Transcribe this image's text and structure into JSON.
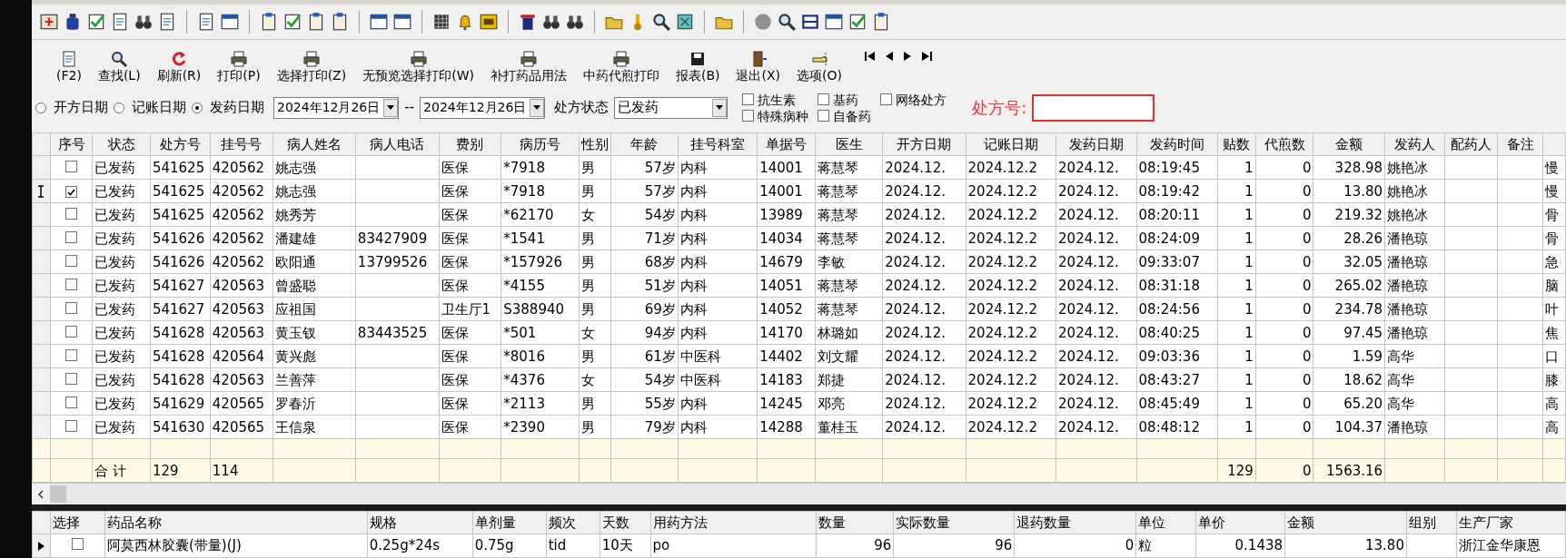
{
  "toolbar": {
    "buttons": [
      {
        "label": "(F2)"
      },
      {
        "label": "查找(L)"
      },
      {
        "label": "刷新(R)"
      },
      {
        "label": "打印(P)"
      },
      {
        "label": "选择打印(Z)"
      },
      {
        "label": "无预览选择打印(W)"
      },
      {
        "label": "补打药品用法"
      },
      {
        "label": "中药代煎打印"
      },
      {
        "label": "报表(B)"
      },
      {
        "label": "退出(X)"
      },
      {
        "label": "选项(O)"
      }
    ]
  },
  "filters": {
    "date_modes": [
      {
        "label": "开方日期",
        "selected": false
      },
      {
        "label": "记账日期",
        "selected": false
      },
      {
        "label": "发药日期",
        "selected": true
      }
    ],
    "date_from": "2024年12月26日",
    "separator": "--",
    "date_to": "2024年12月26日",
    "status_label": "处方状态",
    "status_value": "已发药",
    "options": [
      {
        "label": "抗生素",
        "checked": false
      },
      {
        "label": "特殊病种",
        "checked": false
      },
      {
        "label": "基药",
        "checked": false
      },
      {
        "label": "自备药",
        "checked": false
      },
      {
        "label": "网络处方",
        "checked": false
      }
    ],
    "rx_label": "处方号:"
  },
  "grid": {
    "columns": [
      "序号",
      "状态",
      "处方号",
      "挂号号",
      "病人姓名",
      "病人电话",
      "费别",
      "病历号",
      "性别",
      "年龄",
      "挂号科室",
      "单据号",
      "医生",
      "开方日期",
      "记账日期",
      "发药日期",
      "发药时间",
      "贴数",
      "代煎数",
      "金额",
      "发药人",
      "配药人",
      "备注"
    ],
    "rows": [
      {
        "current": false,
        "checked": false,
        "status": "已发药",
        "rx_no": "541625",
        "reg_no": "420562",
        "patient": "姚志强",
        "fee_type": "医保",
        "record_no": "*7918",
        "sex": "男",
        "age": "57岁",
        "dept": "内科",
        "bill_no": "14001",
        "doctor": "蒋慧琴",
        "rx_date": "2024.12.",
        "acct_date": "2024.12.2",
        "disp_date": "2024.12.",
        "disp_time": "08:19:45",
        "doses": "1",
        "decoct": "0",
        "amount": "328.98",
        "dispenser": "姚艳冰",
        "column_25": "慢"
      },
      {
        "current": true,
        "checked": true,
        "status": "已发药",
        "rx_no": "541625",
        "reg_no": "420562",
        "patient": "姚志强",
        "fee_type": "医保",
        "record_no": "*7918",
        "sex": "男",
        "age": "57岁",
        "dept": "内科",
        "bill_no": "14001",
        "doctor": "蒋慧琴",
        "rx_date": "2024.12.",
        "acct_date": "2024.12.2",
        "disp_date": "2024.12.",
        "disp_time": "08:19:42",
        "doses": "1",
        "decoct": "0",
        "amount": "13.80",
        "dispenser": "姚艳冰",
        "column_25": "慢"
      },
      {
        "current": false,
        "checked": false,
        "status": "已发药",
        "rx_no": "541625",
        "reg_no": "420562",
        "patient": "姚秀芳",
        "fee_type": "医保",
        "record_no": "*62170",
        "sex": "女",
        "age": "54岁",
        "dept": "内科",
        "bill_no": "13989",
        "doctor": "蒋慧琴",
        "rx_date": "2024.12.",
        "acct_date": "2024.12.2",
        "disp_date": "2024.12.",
        "disp_time": "08:20:11",
        "doses": "1",
        "decoct": "0",
        "amount": "219.32",
        "dispenser": "姚艳冰",
        "column_25": "骨"
      },
      {
        "current": false,
        "checked": false,
        "status": "已发药",
        "rx_no": "541626",
        "reg_no": "420562",
        "patient": "潘建雄",
        "phone": "83427909",
        "fee_type": "医保",
        "record_no": "*1541",
        "sex": "男",
        "age": "71岁",
        "dept": "内科",
        "bill_no": "14034",
        "doctor": "蒋慧琴",
        "rx_date": "2024.12.",
        "acct_date": "2024.12.2",
        "disp_date": "2024.12.",
        "disp_time": "08:24:09",
        "doses": "1",
        "decoct": "0",
        "amount": "28.26",
        "dispenser": "潘艳琼",
        "column_25": "骨"
      },
      {
        "current": false,
        "checked": false,
        "status": "已发药",
        "rx_no": "541626",
        "reg_no": "420562",
        "patient": "欧阳通",
        "phone": "13799526",
        "fee_type": "医保",
        "record_no": "*157926",
        "sex": "男",
        "age": "68岁",
        "dept": "内科",
        "bill_no": "14679",
        "doctor": "李敏",
        "rx_date": "2024.12.",
        "acct_date": "2024.12.2",
        "disp_date": "2024.12.",
        "disp_time": "09:33:07",
        "doses": "1",
        "decoct": "0",
        "amount": "32.05",
        "dispenser": "潘艳琼",
        "column_25": "急"
      },
      {
        "current": false,
        "checked": false,
        "status": "已发药",
        "rx_no": "541627",
        "reg_no": "420563",
        "patient": "曾盛聪",
        "fee_type": "医保",
        "record_no": "*4155",
        "sex": "男",
        "age": "51岁",
        "dept": "内科",
        "bill_no": "14051",
        "doctor": "蒋慧琴",
        "rx_date": "2024.12.",
        "acct_date": "2024.12.2",
        "disp_date": "2024.12.",
        "disp_time": "08:31:18",
        "doses": "1",
        "decoct": "0",
        "amount": "265.02",
        "dispenser": "潘艳琼",
        "column_25": "脑"
      },
      {
        "current": false,
        "checked": false,
        "status": "已发药",
        "rx_no": "541627",
        "reg_no": "420563",
        "patient": "应祖国",
        "fee_type": "卫生厅1",
        "record_no": "S388940",
        "sex": "男",
        "age": "69岁",
        "dept": "内科",
        "bill_no": "14052",
        "doctor": "蒋慧琴",
        "rx_date": "2024.12.",
        "acct_date": "2024.12.2",
        "disp_date": "2024.12.",
        "disp_time": "08:24:56",
        "doses": "1",
        "decoct": "0",
        "amount": "234.78",
        "dispenser": "潘艳琼",
        "column_25": "叶"
      },
      {
        "current": false,
        "checked": false,
        "status": "已发药",
        "rx_no": "541628",
        "reg_no": "420563",
        "patient": "黄玉钗",
        "phone": "83443525",
        "fee_type": "医保",
        "record_no": "*501",
        "sex": "女",
        "age": "94岁",
        "dept": "内科",
        "bill_no": "14170",
        "doctor": "林璐如",
        "rx_date": "2024.12.",
        "acct_date": "2024.12.2",
        "disp_date": "2024.12.",
        "disp_time": "08:40:25",
        "doses": "1",
        "decoct": "0",
        "amount": "97.45",
        "dispenser": "潘艳琼",
        "column_25": "焦"
      },
      {
        "current": false,
        "checked": false,
        "status": "已发药",
        "rx_no": "541628",
        "reg_no": "420564",
        "patient": "黄兴彪",
        "fee_type": "医保",
        "record_no": "*8016",
        "sex": "男",
        "age": "61岁",
        "dept": "中医科",
        "bill_no": "14402",
        "doctor": "刘文耀",
        "rx_date": "2024.12.",
        "acct_date": "2024.12.2",
        "disp_date": "2024.12.",
        "disp_time": "09:03:36",
        "doses": "1",
        "decoct": "0",
        "amount": "1.59",
        "dispenser": "高华",
        "column_25": "口"
      },
      {
        "current": false,
        "checked": false,
        "status": "已发药",
        "rx_no": "541628",
        "reg_no": "420563",
        "patient": "兰善萍",
        "fee_type": "医保",
        "record_no": "*4376",
        "sex": "女",
        "age": "54岁",
        "dept": "中医科",
        "bill_no": "14183",
        "doctor": "郑捷",
        "rx_date": "2024.12.",
        "acct_date": "2024.12.2",
        "disp_date": "2024.12.",
        "disp_time": "08:43:27",
        "doses": "1",
        "decoct": "0",
        "amount": "18.62",
        "dispenser": "高华",
        "column_25": "膝"
      },
      {
        "current": false,
        "checked": false,
        "status": "已发药",
        "rx_no": "541629",
        "reg_no": "420565",
        "patient": "罗春沂",
        "fee_type": "医保",
        "record_no": "*2113",
        "sex": "男",
        "age": "55岁",
        "dept": "内科",
        "bill_no": "14245",
        "doctor": "邓亮",
        "rx_date": "2024.12.",
        "acct_date": "2024.12.2",
        "disp_date": "2024.12.",
        "disp_time": "08:45:49",
        "doses": "1",
        "decoct": "0",
        "amount": "65.20",
        "dispenser": "高华",
        "column_25": "高"
      },
      {
        "current": false,
        "checked": false,
        "status": "已发药",
        "rx_no": "541630",
        "reg_no": "420565",
        "patient": "王信泉",
        "fee_type": "医保",
        "record_no": "*2390",
        "sex": "男",
        "age": "79岁",
        "dept": "内科",
        "bill_no": "14288",
        "doctor": "董桂玉",
        "rx_date": "2024.12.",
        "acct_date": "2024.12.2",
        "disp_date": "2024.12.",
        "disp_time": "08:48:12",
        "doses": "1",
        "decoct": "0",
        "amount": "104.37",
        "dispenser": "潘艳琼",
        "column_25": "高"
      }
    ],
    "totals": {
      "status": "合  计",
      "rx_no": "129",
      "reg_no": "114",
      "doses": "129",
      "decoct": "0",
      "amount": "1563.16"
    }
  },
  "detail": {
    "columns": [
      "选择",
      "药品名称",
      "规格",
      "单剂量",
      "频次",
      "天数",
      "用药方法",
      "数量",
      "实际数量",
      "退药数量",
      "单位",
      "单价",
      "金额",
      "组别",
      "生产厂家"
    ],
    "rows": [
      {
        "current": true,
        "checked": false,
        "drug": "阿莫西林胶囊(带量)(J)",
        "spec": "0.25g*24s",
        "dose": "0.75g",
        "frequency": "tid",
        "days": "10天",
        "usage": "po",
        "quantity": "96",
        "actual_quantity": "96",
        "returned": "0",
        "unit": "粒",
        "unit_price": "0.1438",
        "amount": "13.80",
        "maker": "浙江金华康恩"
      }
    ]
  }
}
